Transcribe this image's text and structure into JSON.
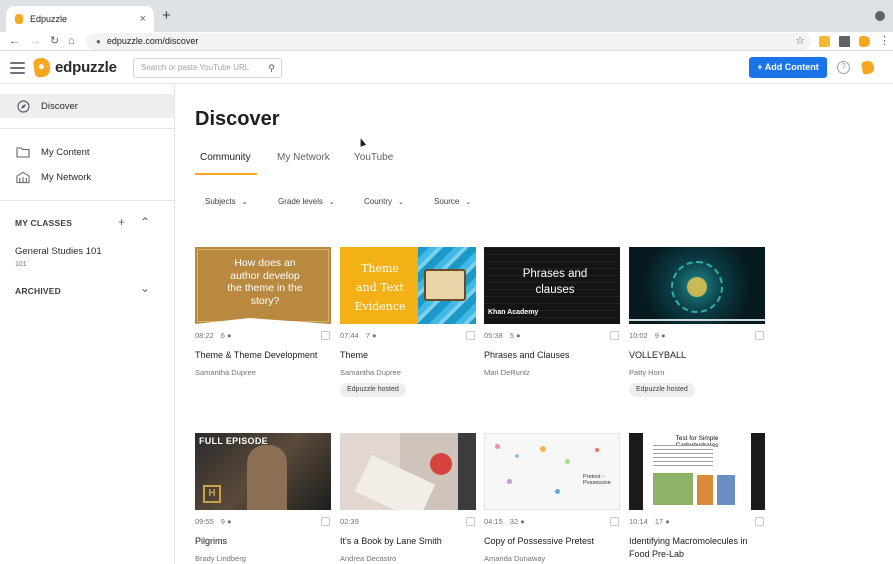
{
  "browser": {
    "tab_title": "Edpuzzle",
    "tab_close": "×",
    "new_tab": "+",
    "url": "edpuzzle.com/discover",
    "back": "←",
    "forward": "→",
    "reload": "↻",
    "home": "⌂",
    "bookmark": "☆",
    "menu": "⋮"
  },
  "header": {
    "logo_text": "edpuzzle",
    "search_placeholder": "Search or paste YouTube URL",
    "add_content_label": "Add Content",
    "add_icon": "+",
    "help_icon": "?"
  },
  "sidebar": {
    "items": [
      {
        "label": "Discover",
        "icon": "compass-icon"
      },
      {
        "label": "My Content",
        "icon": "folder-icon"
      },
      {
        "label": "My Network",
        "icon": "school-icon"
      }
    ],
    "my_classes_label": "MY CLASSES",
    "add_class": "+",
    "class_name": "General Studies 101",
    "class_code": "101",
    "archived_label": "ARCHIVED"
  },
  "main": {
    "title": "Discover",
    "tabs": [
      "Community",
      "My Network",
      "YouTube"
    ],
    "filters": [
      "Subjects",
      "Grade levels",
      "Country",
      "Source"
    ],
    "cards": [
      {
        "duration": "08:22",
        "questions": "6",
        "title": "Theme & Theme Development",
        "author": "Samantha Dupree",
        "badge": "",
        "thumb_text": "How does an author develop the theme in the story?"
      },
      {
        "duration": "07:44",
        "questions": "7",
        "title": "Theme",
        "author": "Samantha Dupree",
        "badge": "Edpuzzle hosted",
        "thumb_text": "Theme and Text Evidence"
      },
      {
        "duration": "05:38",
        "questions": "5",
        "title": "Phrases and Clauses",
        "author": "Mari DeRuntz",
        "badge": "",
        "thumb_text": "Phrases and clauses",
        "thumb_sub": "Khan Academy"
      },
      {
        "duration": "10:02",
        "questions": "9",
        "title": "VOLLEYBALL",
        "author": "Patty Horn",
        "badge": "Edpuzzle hosted",
        "thumb_text": ""
      },
      {
        "duration": "09:55",
        "questions": "9",
        "title": "Pilgrims",
        "author": "Brady Lindberg",
        "badge": "",
        "thumb_text": "FULL EPISODE"
      },
      {
        "duration": "02:39",
        "questions": "",
        "title": "It's a Book by Lane Smith",
        "author": "Andrea Decastro",
        "badge": "",
        "thumb_text": ""
      },
      {
        "duration": "04:15",
        "questions": "32",
        "title": "Copy of Possessive Pretest",
        "author": "Amanda Dunaway",
        "badge": "",
        "thumb_text": "Pretest - Possessive"
      },
      {
        "duration": "10:14",
        "questions": "17",
        "title": "Identifying Macromolecules in Food Pre-Lab",
        "author": "",
        "badge": "",
        "thumb_text": "Test for Simple Carbohydrates"
      }
    ]
  },
  "colors": {
    "accent": "#f7a823",
    "primary": "#1a73e8"
  }
}
